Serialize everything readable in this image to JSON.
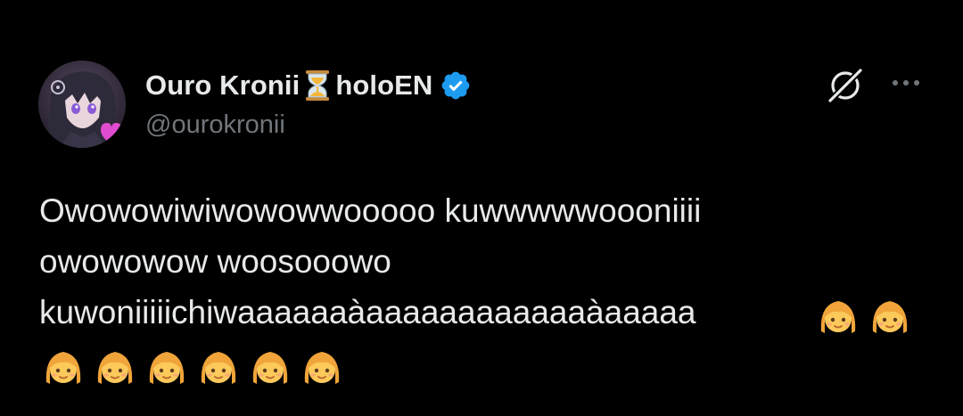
{
  "author": {
    "display_name_part1": "Ouro Kronii",
    "display_name_part2": "holoEN",
    "handle": "@ourokronii",
    "name_emoji": "hourglass-emoji",
    "verified_badge_color": "#1d9bf0"
  },
  "tweet": {
    "text": "Owowowiwiwowowwooooo kuwwwwwoooniiii\nowowowow woosooowo\nkuwoniiiiichiwaaaaaaàaaaaaaaaaaaaàaaaaa",
    "trailing_emojis_line3": [
      "person-emoji",
      "person-emoji"
    ],
    "trailing_emojis_line4": [
      "person-emoji",
      "person-emoji",
      "person-emoji",
      "person-emoji",
      "person-emoji",
      "person-emoji"
    ]
  },
  "actions": {
    "grok_icon": "grok-icon",
    "more_icon": "more-dots-icon"
  },
  "colors": {
    "background": "#000000",
    "primary_text": "#e7e9ea",
    "secondary_text": "#71767b",
    "accent": "#1d9bf0"
  }
}
